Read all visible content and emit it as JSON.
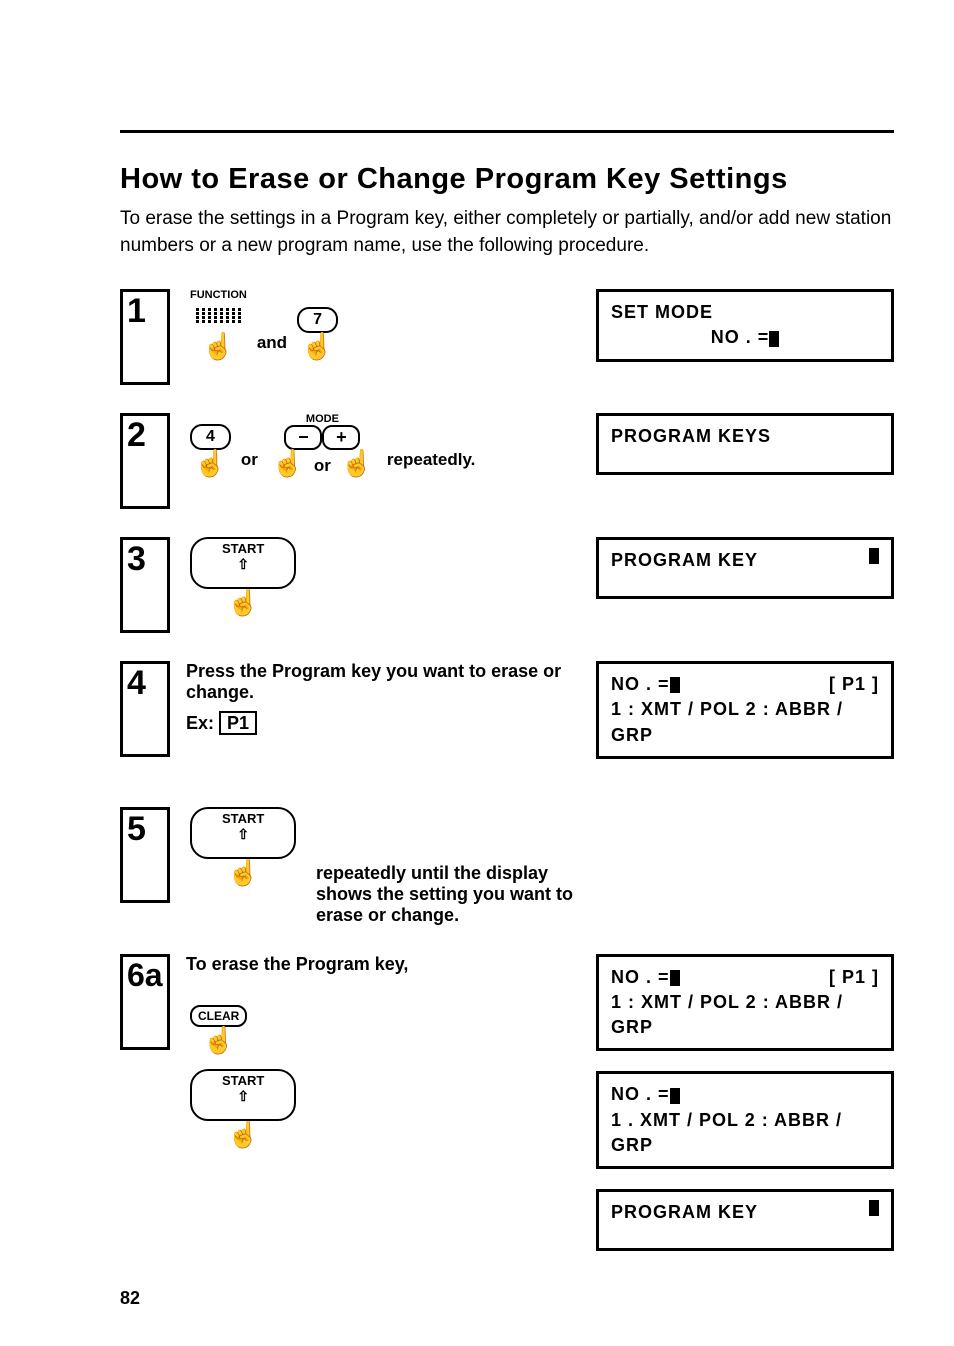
{
  "title": "How to Erase or Change Program Key Settings",
  "intro": "To erase the settings in a Program key, either completely or partially, and/or add new station numbers or a new program name, use the following procedure.",
  "steps": {
    "s1": {
      "num": "1",
      "func_label": "FUNCTION",
      "key7": "7",
      "and": "and",
      "disp_l1": "SET  MODE",
      "disp_l2_pre": "NO . ="
    },
    "s2": {
      "num": "2",
      "mode_label": "MODE",
      "key4": "4",
      "minus": "−",
      "plus": "+",
      "or": "or",
      "rep": "repeatedly.",
      "disp_l1": "PROGRAM  KEYS"
    },
    "s3": {
      "num": "3",
      "start": "START",
      "disp_l1": "PROGRAM  KEY"
    },
    "s4": {
      "num": "4",
      "text": "Press the Program key you want to erase or change.",
      "ex": "Ex:",
      "p1": "P1",
      "disp_l1a": "NO . =",
      "disp_l1b": "[ P1 ]",
      "disp_l2": "1 : XMT / POL   2 : ABBR / GRP"
    },
    "s5": {
      "num": "5",
      "start": "START",
      "tail": "repeatedly until the display shows the setting you want to erase or change."
    },
    "s6a": {
      "num": "6a",
      "text": "To erase the Program key,",
      "clear": "CLEAR",
      "start": "START",
      "d1_a": "NO . =",
      "d1_b": "[ P1 ]",
      "d1_l2": "1 : XMT / POL   2 : ABBR / GRP",
      "d2_a": "NO . =",
      "d2_l2": "1 . XMT / POL   2 : ABBR / GRP",
      "d3": "PROGRAM  KEY"
    }
  },
  "page_number": "82"
}
